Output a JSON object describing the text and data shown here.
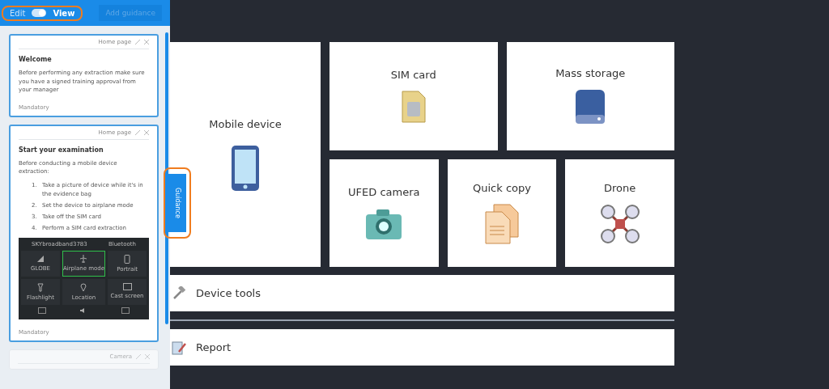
{
  "sidebar": {
    "mode_toggle": {
      "edit_label": "Edit",
      "view_label": "View",
      "view_on": true
    },
    "add_button": {
      "label": "Add guidance",
      "disabled": true
    },
    "cards": [
      {
        "location": "Home page",
        "title": "Welcome",
        "body": "Before performing any extraction make sure you have a signed training approval from your manager",
        "footer": "Mandatory",
        "disabled": false
      },
      {
        "location": "Home page",
        "title": "Start your examination",
        "body": "Before conducting a mobile device extraction:",
        "steps": [
          {
            "number": "1.",
            "text": "Take a picture of device while it's in the evidence bag"
          },
          {
            "number": "2.",
            "text": "Set the device to airplane mode"
          },
          {
            "number": "3.",
            "text": "Take off the SIM card"
          },
          {
            "number": "4.",
            "text": "Perform a SIM card extraction"
          }
        ],
        "screenshot": {
          "network": "SKYbroadband3783",
          "bluetooth": "Bluetooth",
          "tiles": [
            {
              "label": "GLOBE",
              "kind": "signal",
              "selected": false
            },
            {
              "label": "Airplane mode",
              "kind": "plane",
              "selected": true
            },
            {
              "label": "Portrait",
              "kind": "phone",
              "selected": false
            },
            {
              "label": "Flashlight",
              "kind": "torch",
              "selected": false
            },
            {
              "label": "Location",
              "kind": "pin",
              "selected": false
            },
            {
              "label": "Cast screen",
              "kind": "cast",
              "selected": false
            }
          ]
        },
        "footer": "Mandatory",
        "disabled": false
      },
      {
        "location": "Camera",
        "disabled": true
      }
    ]
  },
  "guidance_tab": "Guidance",
  "tiles": [
    {
      "label": "Mobile device",
      "kind": "phone"
    },
    {
      "label": "SIM card",
      "kind": "sim"
    },
    {
      "label": "Mass storage",
      "kind": "drive"
    },
    {
      "label": "UFED camera",
      "kind": "camera"
    },
    {
      "label": "Quick copy",
      "kind": "copy"
    },
    {
      "label": "Drone",
      "kind": "drone"
    }
  ],
  "tools": [
    {
      "label": "Device tools",
      "kind": "tools"
    },
    {
      "label": "Report",
      "kind": "report"
    }
  ]
}
